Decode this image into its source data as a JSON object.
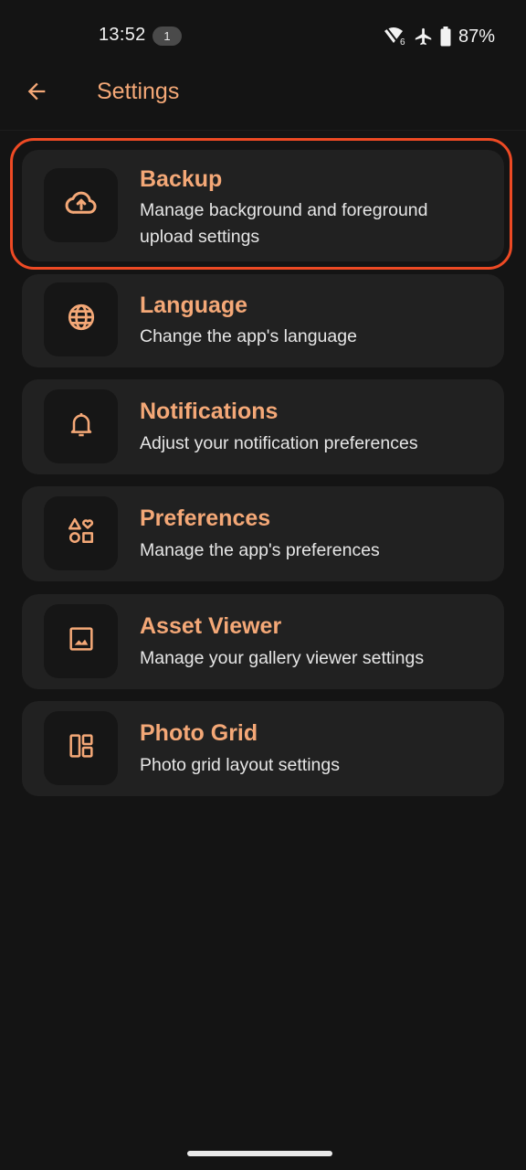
{
  "status_bar": {
    "time": "13:52",
    "notification_count": "1",
    "battery": "87%",
    "icons": [
      "wifi-icon",
      "airplane-mode-icon",
      "battery-icon"
    ]
  },
  "app_bar": {
    "back_icon": "arrow-back-icon",
    "title": "Settings"
  },
  "settings": [
    {
      "key": "backup",
      "icon": "cloud-upload-icon",
      "title": "Backup",
      "subtitle": "Manage background and foreground upload settings",
      "highlighted": true
    },
    {
      "key": "language",
      "icon": "globe-icon",
      "title": "Language",
      "subtitle": "Change the app's language"
    },
    {
      "key": "notifications",
      "icon": "bell-icon",
      "title": "Notifications",
      "subtitle": "Adjust your notification preferences"
    },
    {
      "key": "preferences",
      "icon": "shapes-icon",
      "title": "Preferences",
      "subtitle": "Manage the app's preferences"
    },
    {
      "key": "asset-viewer",
      "icon": "image-icon",
      "title": "Asset Viewer",
      "subtitle": "Manage your gallery viewer settings"
    },
    {
      "key": "photo-grid",
      "icon": "grid-layout-icon",
      "title": "Photo Grid",
      "subtitle": "Photo grid layout settings"
    }
  ],
  "colors": {
    "background": "#141414",
    "card": "#212121",
    "icon_tile": "#161616",
    "accent": "#f4a877",
    "highlight": "#ee4a24"
  }
}
